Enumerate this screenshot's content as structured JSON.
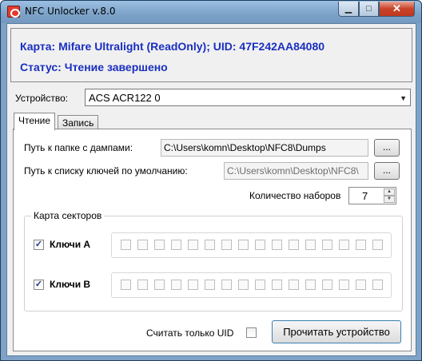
{
  "window": {
    "title": "NFC Unlocker v.8.0",
    "controls": {
      "minimize": "▁",
      "maximize": "□",
      "close": "✕"
    }
  },
  "info": {
    "card_line": "Карта: Mifare Ultralight (ReadOnly); UID: 47F242AA84080",
    "status_line": "Статус: Чтение завершено"
  },
  "device": {
    "label": "Устройство:",
    "selected": "ACS ACR122 0"
  },
  "tabs": [
    {
      "label": "Чтение",
      "active": true
    },
    {
      "label": "Запись",
      "active": false
    }
  ],
  "read_tab": {
    "dumps_folder": {
      "label": "Путь к папке с дампами:",
      "value": "C:\\Users\\komn\\Desktop\\NFC8\\Dumps",
      "browse": "..."
    },
    "keys_list": {
      "label": "Путь к списку ключей по умолчанию:",
      "value": "C:\\Users\\komn\\Desktop\\NFC8\\",
      "browse": "..."
    },
    "sets_count": {
      "label": "Количество наборов",
      "value": "7"
    },
    "sector_map": {
      "legend": "Карта секторов",
      "keys_a": {
        "label": "Ключи A",
        "checked": true,
        "sectors": 16
      },
      "keys_b": {
        "label": "Ключи B",
        "checked": true,
        "sectors": 16
      }
    },
    "uid_only": {
      "label": "Считать только UID",
      "checked": false
    },
    "read_button": "Прочитать устройство"
  },
  "colors": {
    "info_text": "#1a2fc0",
    "titlebar": "#7fa2c6",
    "close_button": "#c9432a"
  }
}
